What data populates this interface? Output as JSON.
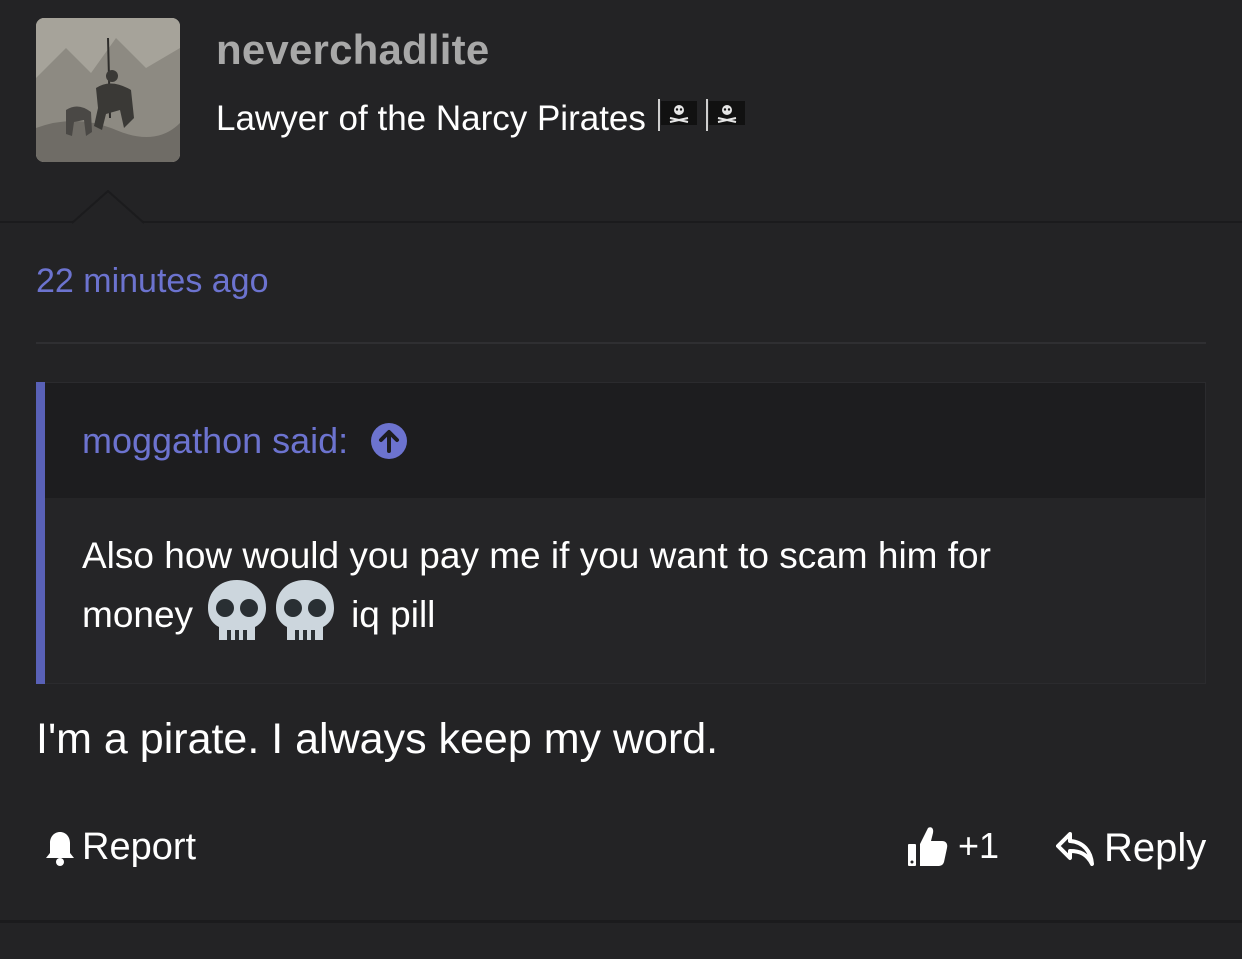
{
  "post": {
    "username": "neverchadlite",
    "user_title": "Lawyer of the Narcy Pirates",
    "timestamp": "22 minutes ago",
    "quote": {
      "author_text": "moggathon said:",
      "line1": "Also how would you pay me if you want to scam him for",
      "line2_start": "money",
      "line2_end": "iq pill"
    },
    "message": "I'm a pirate. I always keep my word.",
    "actions": {
      "report_label": "Report",
      "like_count": "+1",
      "reply_label": "Reply"
    }
  },
  "colors": {
    "background": "#232325",
    "accent": "#6c73cf",
    "quote_bar": "#5961b7",
    "username": "#a8a8a8"
  },
  "icons": [
    "pirate-flag-icon",
    "arrow-up-circle-icon",
    "skull-icon",
    "bell-icon",
    "thumbs-up-icon",
    "reply-arrow-icon"
  ]
}
